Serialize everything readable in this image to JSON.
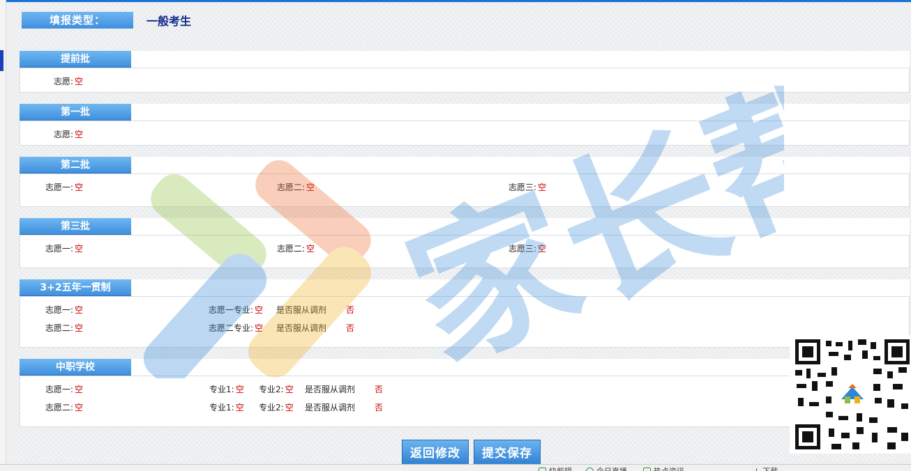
{
  "form_type": {
    "label": "填报类型：",
    "value": "一般考生"
  },
  "sections": {
    "early": {
      "title": "提前批",
      "c1_label": "志愿:",
      "c1_value": "空"
    },
    "first": {
      "title": "第一批",
      "c1_label": "志愿:",
      "c1_value": "空"
    },
    "second": {
      "title": "第二批",
      "c1_label": "志愿一:",
      "c1_value": "空",
      "c2_label": "志愿二:",
      "c2_value": "空",
      "c3_label": "志愿三:",
      "c3_value": "空"
    },
    "third": {
      "title": "第三批",
      "c1_label": "志愿一:",
      "c1_value": "空",
      "c2_label": "志愿二:",
      "c2_value": "空",
      "c3_label": "志愿三:",
      "c3_value": "空"
    },
    "five_year": {
      "title": "3+2五年一贯制",
      "rows": [
        {
          "choice_label": "志愿一:",
          "choice_value": "空",
          "major_label": "志愿一专业:",
          "major_value": "空",
          "adjust_label": "是否服从调剂",
          "adjust_value": "否"
        },
        {
          "choice_label": "志愿二:",
          "choice_value": "空",
          "major_label": "志愿二专业:",
          "major_value": "空",
          "adjust_label": "是否服从调剂",
          "adjust_value": "否"
        }
      ]
    },
    "vocational": {
      "title": "中职学校",
      "rows": [
        {
          "choice_label": "志愿一:",
          "choice_value": "空",
          "major1_label": "专业1:",
          "major1_value": "空",
          "major2_label": "专业2:",
          "major2_value": "空",
          "adjust_label": "是否服从调剂",
          "adjust_value": "否"
        },
        {
          "choice_label": "志愿二:",
          "choice_value": "空",
          "major1_label": "专业1:",
          "major1_value": "空",
          "major2_label": "专业2:",
          "major2_value": "空",
          "adjust_label": "是否服从调剂",
          "adjust_value": "否"
        }
      ]
    }
  },
  "buttons": {
    "back": "返回修改",
    "submit": "提交保存"
  },
  "watermark": {
    "text": "家长帮"
  },
  "taskbar": {
    "items": [
      "快剪辑",
      "今日直播",
      "热点资讯",
      "下载"
    ]
  },
  "colors": {
    "accent": "#3e8fde",
    "value_red": "#cc0000",
    "type_value": "#0f2a8a"
  }
}
